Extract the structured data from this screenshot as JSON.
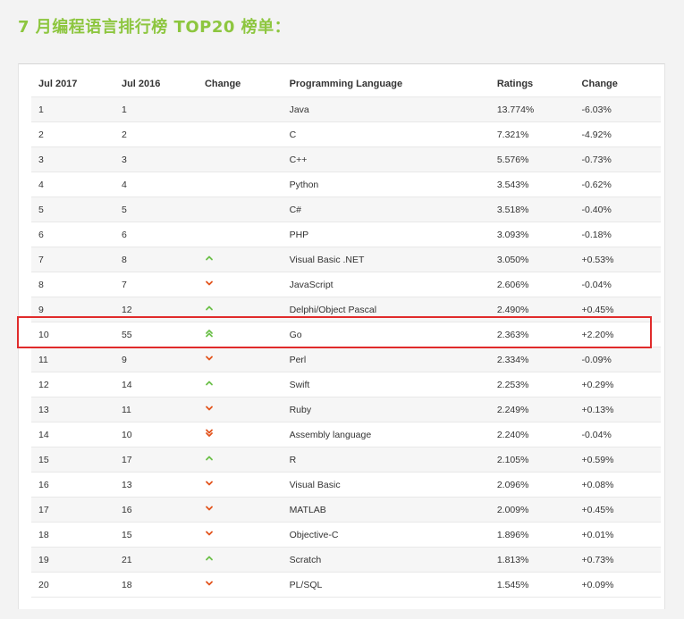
{
  "title": "7 月编程语言排行榜 TOP20 榜单：",
  "colors": {
    "title": "#8dc63f",
    "up": "#6cc04a",
    "down": "#e2541d",
    "highlight": "#e02b2b"
  },
  "table": {
    "headers": [
      "Jul 2017",
      "Jul 2016",
      "Change",
      "Programming Language",
      "Ratings",
      "Change"
    ],
    "rows": [
      {
        "rank": "1",
        "prev": "1",
        "trend": "none",
        "language": "Java",
        "rating": "13.774%",
        "change": "-6.03%"
      },
      {
        "rank": "2",
        "prev": "2",
        "trend": "none",
        "language": "C",
        "rating": "7.321%",
        "change": "-4.92%"
      },
      {
        "rank": "3",
        "prev": "3",
        "trend": "none",
        "language": "C++",
        "rating": "5.576%",
        "change": "-0.73%"
      },
      {
        "rank": "4",
        "prev": "4",
        "trend": "none",
        "language": "Python",
        "rating": "3.543%",
        "change": "-0.62%"
      },
      {
        "rank": "5",
        "prev": "5",
        "trend": "none",
        "language": "C#",
        "rating": "3.518%",
        "change": "-0.40%"
      },
      {
        "rank": "6",
        "prev": "6",
        "trend": "none",
        "language": "PHP",
        "rating": "3.093%",
        "change": "-0.18%"
      },
      {
        "rank": "7",
        "prev": "8",
        "trend": "up",
        "language": "Visual Basic .NET",
        "rating": "3.050%",
        "change": "+0.53%"
      },
      {
        "rank": "8",
        "prev": "7",
        "trend": "down",
        "language": "JavaScript",
        "rating": "2.606%",
        "change": "-0.04%"
      },
      {
        "rank": "9",
        "prev": "12",
        "trend": "up",
        "language": "Delphi/Object Pascal",
        "rating": "2.490%",
        "change": "+0.45%"
      },
      {
        "rank": "10",
        "prev": "55",
        "trend": "up2",
        "language": "Go",
        "rating": "2.363%",
        "change": "+2.20%"
      },
      {
        "rank": "11",
        "prev": "9",
        "trend": "down",
        "language": "Perl",
        "rating": "2.334%",
        "change": "-0.09%"
      },
      {
        "rank": "12",
        "prev": "14",
        "trend": "up",
        "language": "Swift",
        "rating": "2.253%",
        "change": "+0.29%"
      },
      {
        "rank": "13",
        "prev": "11",
        "trend": "down",
        "language": "Ruby",
        "rating": "2.249%",
        "change": "+0.13%"
      },
      {
        "rank": "14",
        "prev": "10",
        "trend": "down2",
        "language": "Assembly language",
        "rating": "2.240%",
        "change": "-0.04%"
      },
      {
        "rank": "15",
        "prev": "17",
        "trend": "up",
        "language": "R",
        "rating": "2.105%",
        "change": "+0.59%"
      },
      {
        "rank": "16",
        "prev": "13",
        "trend": "down",
        "language": "Visual Basic",
        "rating": "2.096%",
        "change": "+0.08%"
      },
      {
        "rank": "17",
        "prev": "16",
        "trend": "down",
        "language": "MATLAB",
        "rating": "2.009%",
        "change": "+0.45%"
      },
      {
        "rank": "18",
        "prev": "15",
        "trend": "down",
        "language": "Objective-C",
        "rating": "1.896%",
        "change": "+0.01%"
      },
      {
        "rank": "19",
        "prev": "21",
        "trend": "up",
        "language": "Scratch",
        "rating": "1.813%",
        "change": "+0.73%"
      },
      {
        "rank": "20",
        "prev": "18",
        "trend": "down",
        "language": "PL/SQL",
        "rating": "1.545%",
        "change": "+0.09%"
      }
    ],
    "highlighted_rank": "10"
  }
}
